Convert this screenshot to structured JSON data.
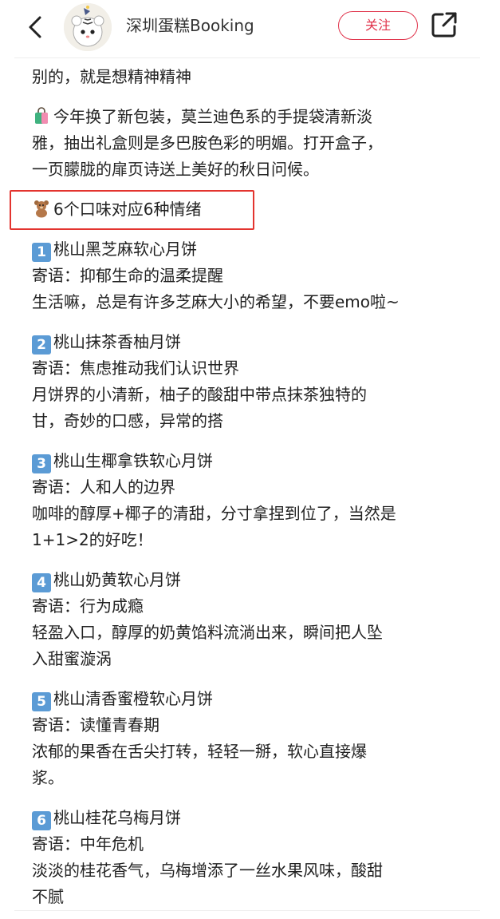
{
  "header": {
    "account_name": "深圳蛋糕Booking",
    "follow_label": "关注"
  },
  "content": {
    "intro_line": "别的，就是想精神精神",
    "packaging_lines": [
      "今年换了新包装，莫兰迪色系的手提袋清新淡",
      "雅，抽出礼盒则是多巴胺色彩的明媚。打开盒子，",
      "一页朦胧的扉页诗送上美好的秋日问候。"
    ],
    "flavors_heading": "6个口味对应6种情绪",
    "flavors": [
      {
        "num": "1",
        "name": "桃山黑芝麻软心月饼",
        "message": "寄语：抑郁生命的温柔提醒",
        "desc": [
          "生活嘛，总是有许多芝麻大小的希望，不要emo啦~"
        ]
      },
      {
        "num": "2",
        "name": "桃山抹茶香柚月饼",
        "message": "寄语：焦虑推动我们认识世界",
        "desc": [
          "月饼界的小清新，柚子的酸甜中带点抹茶独特的",
          "甘，奇妙的口感，异常的搭"
        ]
      },
      {
        "num": "3",
        "name": "桃山生椰拿铁软心月饼",
        "message": "寄语：人和人的边界",
        "desc": [
          "咖啡的醇厚+椰子的清甜，分寸拿捏到位了，当然是",
          "1+1>2的好吃！"
        ]
      },
      {
        "num": "4",
        "name": "桃山奶黄软心月饼",
        "message": "寄语：行为成瘾",
        "desc": [
          "轻盈入口，醇厚的奶黄馅料流淌出来，瞬间把人坠",
          "入甜蜜漩涡"
        ]
      },
      {
        "num": "5",
        "name": "桃山清香蜜橙软心月饼",
        "message": "寄语：读懂青春期",
        "desc": [
          "浓郁的果香在舌尖打转，轻轻一掰，软心直接爆",
          "浆。"
        ]
      },
      {
        "num": "6",
        "name": "桃山桂花乌梅月饼",
        "message": "寄语：中年危机",
        "desc": [
          "淡淡的桂花香气，乌梅增添了一丝水果风味，酸甜",
          "不腻"
        ]
      }
    ]
  },
  "colors": {
    "follow": "#e0334b",
    "highlight_box": "#e3342f",
    "number_badge": "#5b9bd5"
  }
}
